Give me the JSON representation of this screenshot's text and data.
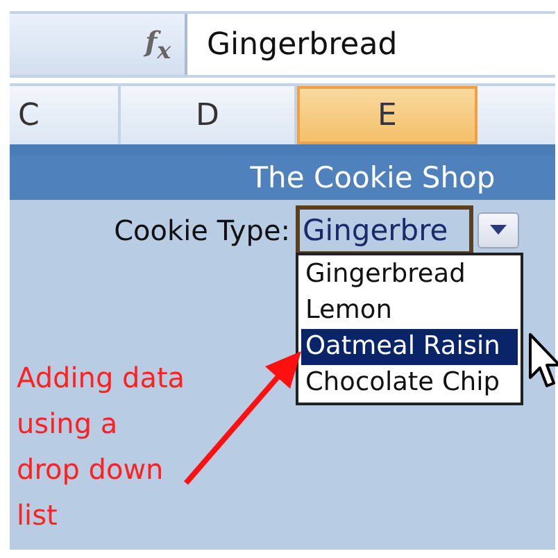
{
  "formula_bar": {
    "function_label": "f$_{x}$",
    "value": "Gingerbread"
  },
  "columns": [
    {
      "label": "C",
      "selected": false
    },
    {
      "label": "D",
      "selected": false
    },
    {
      "label": "E",
      "selected": true
    }
  ],
  "banner": {
    "title": "The Cookie Shop"
  },
  "field": {
    "label": "Cookie Type:",
    "value": "Gingerbre"
  },
  "dropdown": {
    "expanded": true,
    "options": [
      {
        "label": "Gingerbread",
        "selected": false
      },
      {
        "label": "Lemon",
        "selected": false
      },
      {
        "label": "Oatmeal Raisin",
        "selected": true
      },
      {
        "label": "Chocolate Chip",
        "selected": false
      }
    ]
  },
  "annotation": {
    "text": "Adding data using a drop down list"
  }
}
